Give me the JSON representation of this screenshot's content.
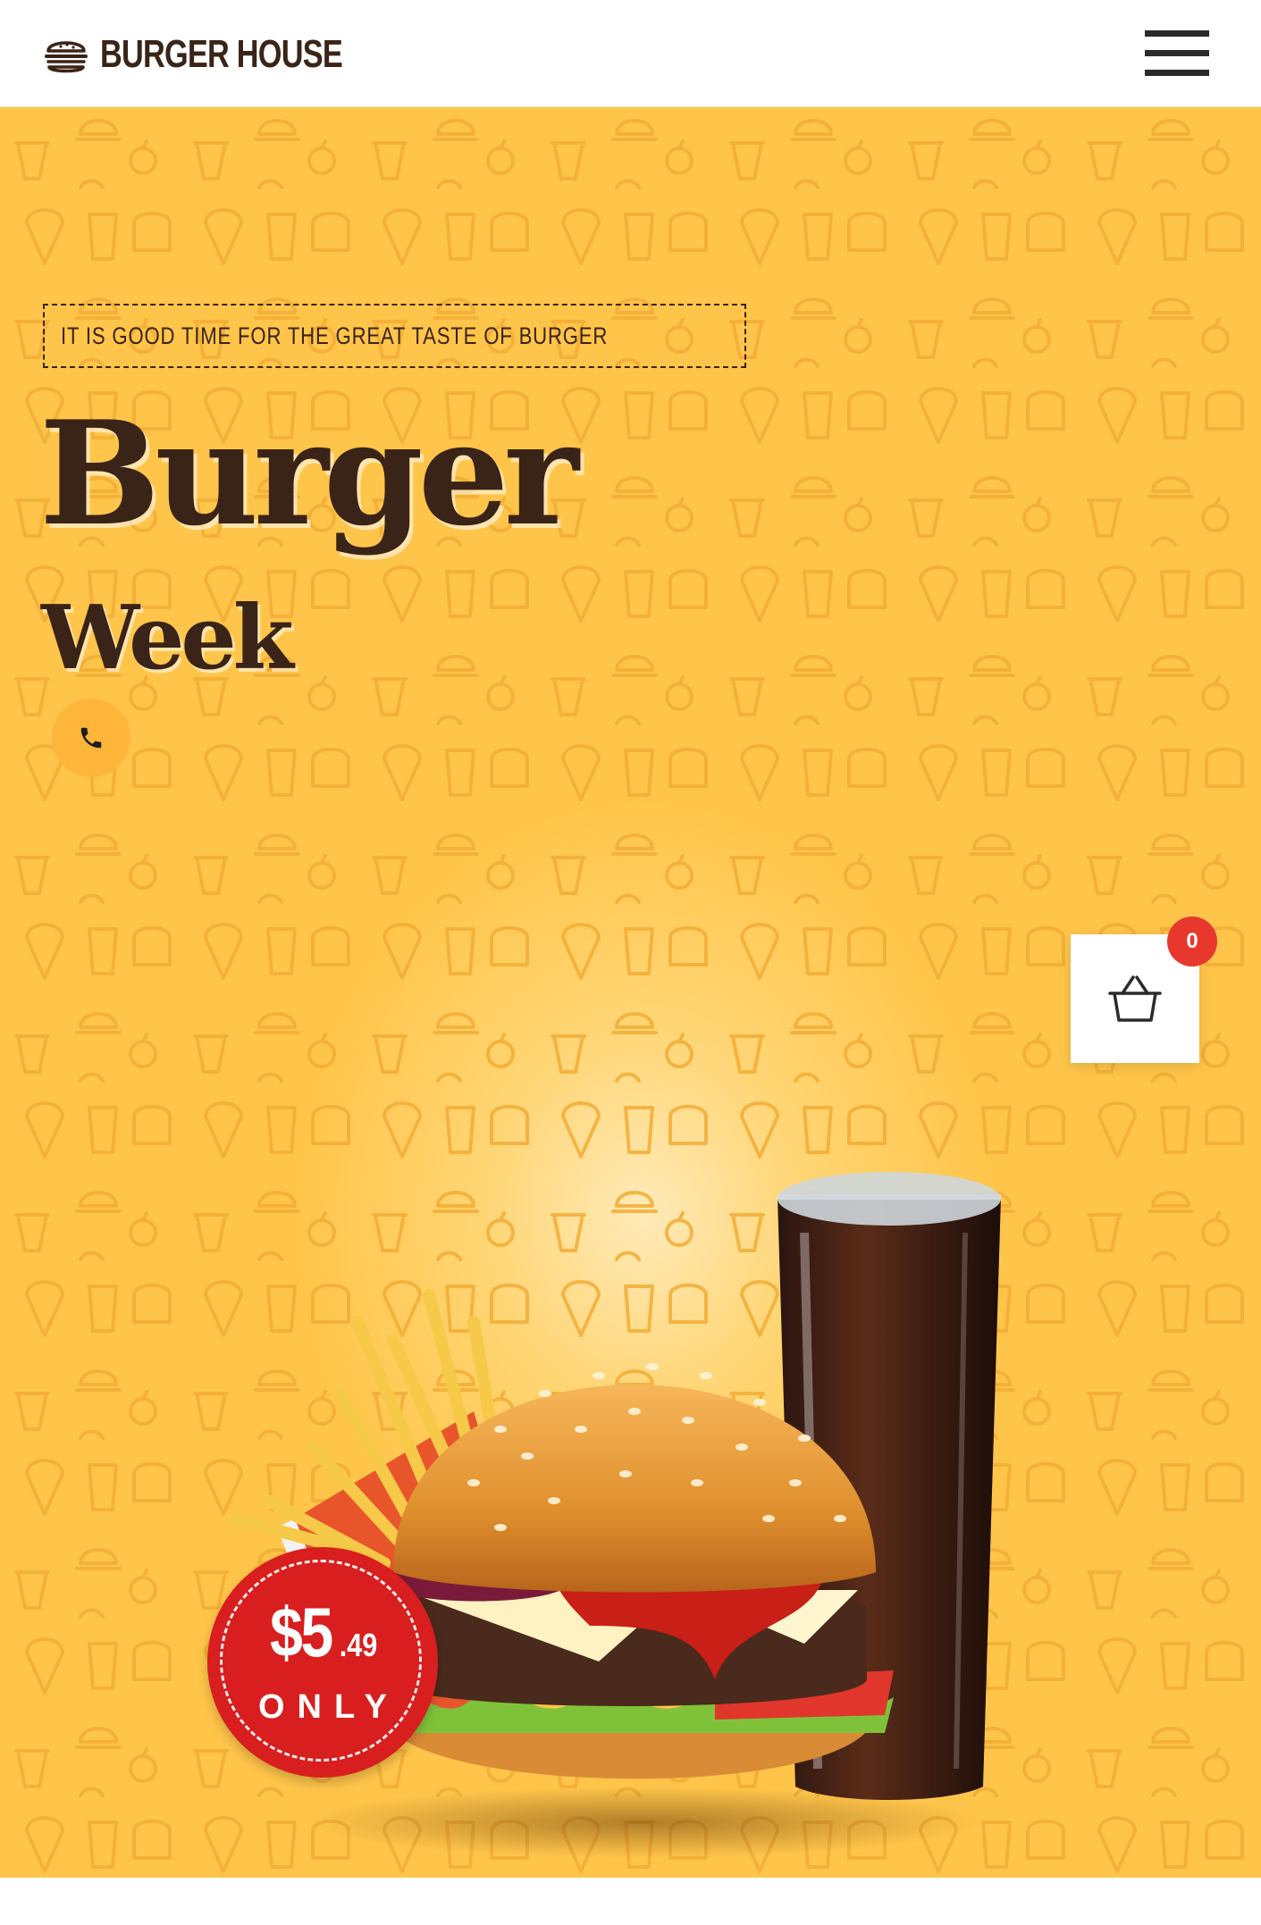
{
  "header": {
    "logo_text": "BURGER HOUSE",
    "logo_icon": "burger-icon",
    "menu_icon": "hamburger-menu-icon"
  },
  "hero": {
    "tagline": "IT IS GOOD TIME FOR THE GREAT TASTE OF BURGER",
    "headline_line1": "Burger",
    "headline_line2": "Week",
    "phone_icon": "phone-icon",
    "price": {
      "dollars": "$5",
      "cents": ".49",
      "label": "ONLY"
    },
    "image": "burger-fries-cola-image"
  },
  "cart": {
    "icon": "shopping-basket-icon",
    "count": "0"
  },
  "colors": {
    "hero_background": "#ffc54a",
    "brand_dark": "#3a2418",
    "badge_red": "#e8382e",
    "price_red": "#d81e1e",
    "phone_button": "#ffb43a"
  }
}
